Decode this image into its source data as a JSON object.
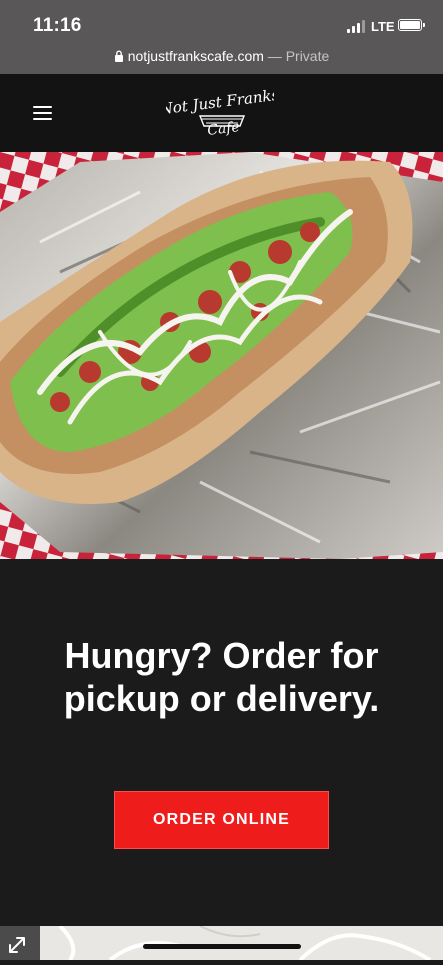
{
  "status_bar": {
    "time": "11:16",
    "network": "LTE",
    "icons": [
      "signal-icon",
      "battery-icon"
    ]
  },
  "browser": {
    "url": "notjustfrankscafe.com",
    "separator": "—",
    "mode": "Private",
    "icons": [
      "lock-icon"
    ]
  },
  "header": {
    "menu_icon": "hamburger-menu-icon",
    "logo_text_line1": "Not Just Franks",
    "logo_text_line2": "Cafe"
  },
  "hero": {
    "image": "wrap sandwich with lettuce, tomato and white sauce on foil"
  },
  "cta": {
    "heading": "Hungry? Order for pickup or delivery.",
    "button_label": "ORDER ONLINE"
  },
  "map": {
    "expand_icon": "expand-arrows-icon"
  },
  "colors": {
    "browser_chrome": "#5a5758",
    "header_bg": "#131313",
    "section_bg": "#1b1b1b",
    "accent": "#ef1c1c"
  }
}
